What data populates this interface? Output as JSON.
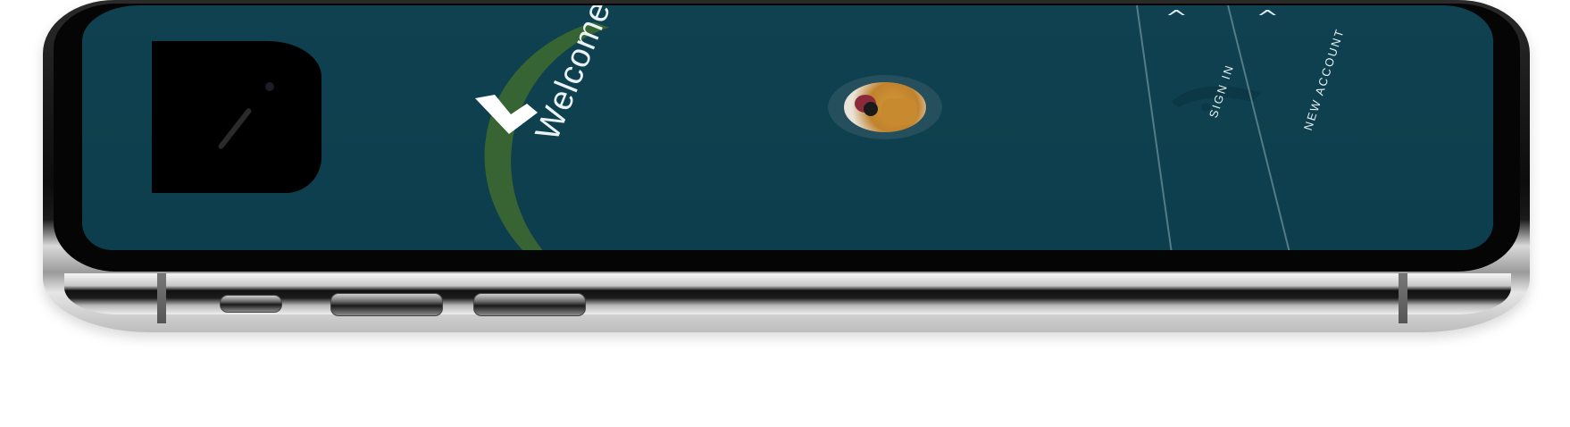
{
  "screen": {
    "welcome_text": "Welcome, Paul!",
    "logo_icon": "chevron-logo-icon",
    "avatar_icon": "profile-photo"
  },
  "nav": {
    "sign_in_label": "SIGN IN",
    "new_account_label": "NEW ACCOUNT",
    "chevron_symbol": "^"
  },
  "colors": {
    "screen_background": "#0f4150",
    "accent_text": "#eaf2f4",
    "wing_green": "#3f6b2e"
  }
}
